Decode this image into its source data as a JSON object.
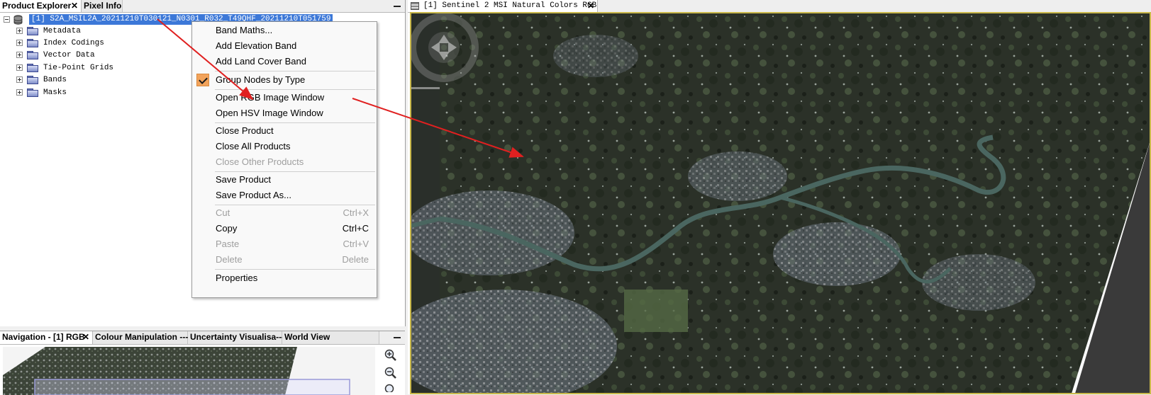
{
  "left_tabs": [
    {
      "label": "Product Explorer",
      "closable": true
    },
    {
      "label": "Pixel Info",
      "closable": false
    }
  ],
  "product": {
    "label": "[1] S2A_MSIL2A_20211210T030121_N0301_R032_T49QHF_20211210T051759",
    "children": [
      "Metadata",
      "Index Codings",
      "Vector Data",
      "Tie-Point Grids",
      "Bands",
      "Masks"
    ]
  },
  "context_menu": {
    "items": [
      {
        "label": "Band Maths...",
        "shortcut": "",
        "disabled": false,
        "checked": false
      },
      {
        "label": "Add Elevation Band",
        "shortcut": "",
        "disabled": false,
        "checked": false
      },
      {
        "label": "Add Land Cover Band",
        "shortcut": "",
        "disabled": false,
        "checked": false
      },
      {
        "label": "Group Nodes by Type",
        "shortcut": "",
        "disabled": false,
        "checked": true
      },
      {
        "label": "Open RGB Image Window",
        "shortcut": "",
        "disabled": false,
        "checked": false
      },
      {
        "label": "Open HSV Image Window",
        "shortcut": "",
        "disabled": false,
        "checked": false
      },
      {
        "label": "Close Product",
        "shortcut": "",
        "disabled": false,
        "checked": false
      },
      {
        "label": "Close All Products",
        "shortcut": "",
        "disabled": false,
        "checked": false
      },
      {
        "label": "Close Other Products",
        "shortcut": "",
        "disabled": true,
        "checked": false
      },
      {
        "label": "Save Product",
        "shortcut": "",
        "disabled": false,
        "checked": false
      },
      {
        "label": "Save Product As...",
        "shortcut": "",
        "disabled": false,
        "checked": false
      },
      {
        "label": "Cut",
        "shortcut": "Ctrl+X",
        "disabled": true,
        "checked": false
      },
      {
        "label": "Copy",
        "shortcut": "Ctrl+C",
        "disabled": false,
        "checked": false
      },
      {
        "label": "Paste",
        "shortcut": "Ctrl+V",
        "disabled": true,
        "checked": false
      },
      {
        "label": "Delete",
        "shortcut": "Delete",
        "disabled": true,
        "checked": false
      },
      {
        "label": "Properties",
        "shortcut": "",
        "disabled": false,
        "checked": false
      }
    ]
  },
  "bottom_tabs": [
    {
      "label": "Navigation - [1] RGB",
      "closable": true
    },
    {
      "label": "Colour Manipulation ---",
      "closable": false
    },
    {
      "label": "Uncertainty Visualisa---",
      "closable": false
    },
    {
      "label": "World View",
      "closable": false
    }
  ],
  "image_window": {
    "tab_label": "[1] Sentinel 2 MSI Natural Colors RGB",
    "closable": true
  },
  "colors": {
    "selection": "#3c78d8",
    "checked_bg": "#f2a35b",
    "image_border": "#c9b84a",
    "annotation_arrow": "#e02020"
  },
  "icons": {
    "close": "close-icon",
    "minimize": "minimize-icon",
    "folder": "folder-icon",
    "product": "product-db-icon",
    "zoom_in": "zoom-in-icon",
    "zoom_out": "zoom-out-icon",
    "pan": "pan-compass-icon"
  }
}
